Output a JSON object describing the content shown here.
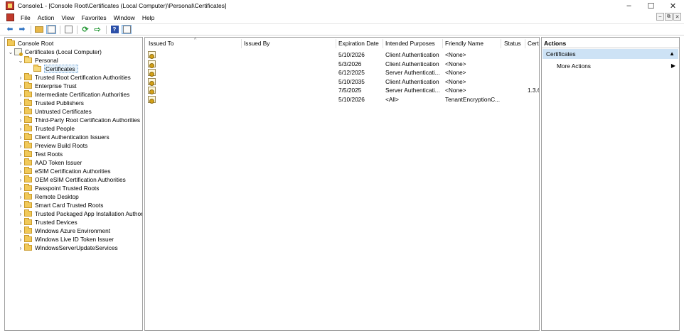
{
  "window": {
    "title": "Console1 - [Console Root\\Certificates (Local Computer)\\Personal\\Certificates]",
    "controls": [
      "–",
      "☐",
      "✕"
    ]
  },
  "menu": {
    "items": [
      "File",
      "Action",
      "View",
      "Favorites",
      "Window",
      "Help"
    ],
    "mdi_controls": [
      "–",
      "⧉",
      "✕"
    ]
  },
  "toolbar": {
    "buttons": [
      "back-arrow-icon",
      "forward-arrow-icon",
      "up-folder-icon",
      "show-hide-tree-icon",
      "properties-icon",
      "refresh-icon",
      "export-list-icon",
      "help-icon",
      "show-hide-action-pane-icon"
    ]
  },
  "tree": {
    "root": "Console Root",
    "computer": "Certificates (Local Computer)",
    "personal": "Personal",
    "selected": "Certificates",
    "stores": [
      "Trusted Root Certification Authorities",
      "Enterprise Trust",
      "Intermediate Certification Authorities",
      "Trusted Publishers",
      "Untrusted Certificates",
      "Third-Party Root Certification Authorities",
      "Trusted People",
      "Client Authentication Issuers",
      "Preview Build Roots",
      "Test Roots",
      "AAD Token Issuer",
      "eSIM Certification Authorities",
      "OEM eSIM Certification Authorities",
      "Passpoint Trusted Roots",
      "Remote Desktop",
      "Smart Card Trusted Roots",
      "Trusted Packaged App Installation Authorit",
      "Trusted Devices",
      "Windows Azure Environment",
      "Windows Live ID Token Issuer",
      "WindowsServerUpdateServices"
    ]
  },
  "list": {
    "columns": [
      "Issued To",
      "Issued By",
      "Expiration Date",
      "Intended Purposes",
      "Friendly Name",
      "Status",
      "Certi"
    ],
    "rows": [
      {
        "issued_to": "",
        "issued_by": "",
        "expiration": "5/10/2026",
        "purposes": "Client Authentication",
        "friendly": "<None>",
        "status": "",
        "cert": ""
      },
      {
        "issued_to": "",
        "issued_by": "",
        "expiration": "5/3/2026",
        "purposes": "Client Authentication",
        "friendly": "<None>",
        "status": "",
        "cert": ""
      },
      {
        "issued_to": "",
        "issued_by": "",
        "expiration": "6/12/2025",
        "purposes": "Server Authenticati...",
        "friendly": "<None>",
        "status": "",
        "cert": ""
      },
      {
        "issued_to": "",
        "issued_by": "",
        "expiration": "5/10/2035",
        "purposes": "Client Authentication",
        "friendly": "<None>",
        "status": "",
        "cert": ""
      },
      {
        "issued_to": "",
        "issued_by": "",
        "expiration": "7/5/2025",
        "purposes": "Server Authenticati...",
        "friendly": "<None>",
        "status": "",
        "cert": "1.3.6"
      },
      {
        "issued_to": "",
        "issued_by": "",
        "expiration": "5/10/2026",
        "purposes": "<All>",
        "friendly": "TenantEncryptionC...",
        "status": "",
        "cert": ""
      }
    ]
  },
  "actions": {
    "title": "Actions",
    "section": "Certificates",
    "section_caret": "▲",
    "item": "More Actions",
    "item_caret": "▶"
  }
}
